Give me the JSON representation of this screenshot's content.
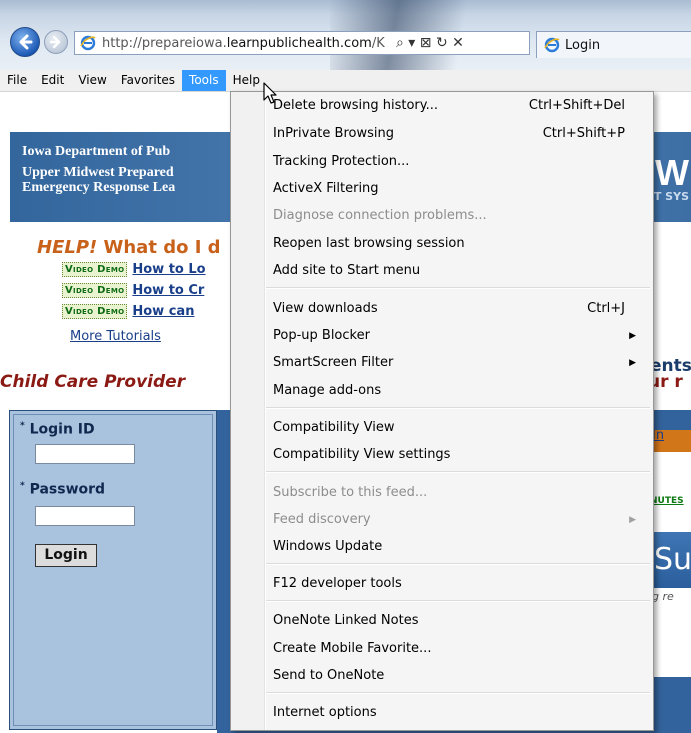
{
  "browser": {
    "address_url_pre": "http://prepareiowa.",
    "address_url_domain": "learnpublichealth.com",
    "address_url_post": "/K",
    "address_controls": "⌕ ▾ ⊠ ↻ ✕",
    "tab_title": "Login"
  },
  "menubar": {
    "items": [
      "File",
      "Edit",
      "View",
      "Favorites",
      "Tools",
      "Help"
    ],
    "active": "Tools"
  },
  "page": {
    "banner_line1": "Iowa Department of Pub",
    "banner_line2a": "Upper Midwest Prepared",
    "banner_line2b": "Emergency Response Lea",
    "banner_right_big": "OW",
    "banner_right_small": "T SYS",
    "help_prefix": "HELP!",
    "help_rest": " What do I d",
    "demos": [
      {
        "badge": "Video Demo",
        "link": "How to Lo"
      },
      {
        "badge": "Video Demo",
        "link": "How to Cr"
      },
      {
        "badge": "Video Demo",
        "link": "How can"
      }
    ],
    "more_tutorials": "More Tutorials",
    "ccp_left": "Child Care Provider",
    "ccp_right": "ur r",
    "login": {
      "login_id_label": "Login ID",
      "password_label": "Password",
      "login_button": "Login",
      "required_mark": "*"
    },
    "right_ents": "ents",
    "right_in": "In",
    "right_nutes": "NUTES",
    "right_su": "Su",
    "right_re": "ng re"
  },
  "tools_menu": {
    "items": [
      {
        "label": "Delete browsing history...",
        "shortcut": "Ctrl+Shift+Del",
        "disabled": false,
        "submenu": false
      },
      {
        "label": "InPrivate Browsing",
        "shortcut": "Ctrl+Shift+P",
        "disabled": false,
        "submenu": false
      },
      {
        "label": "Tracking Protection...",
        "shortcut": "",
        "disabled": false,
        "submenu": false
      },
      {
        "label": "ActiveX Filtering",
        "shortcut": "",
        "disabled": false,
        "submenu": false
      },
      {
        "label": "Diagnose connection problems...",
        "shortcut": "",
        "disabled": true,
        "submenu": false
      },
      {
        "label": "Reopen last browsing session",
        "shortcut": "",
        "disabled": false,
        "submenu": false
      },
      {
        "label": "Add site to Start menu",
        "shortcut": "",
        "disabled": false,
        "submenu": false
      },
      {
        "label": "View downloads",
        "shortcut": "Ctrl+J",
        "disabled": false,
        "submenu": false
      },
      {
        "label": "Pop-up Blocker",
        "shortcut": "",
        "disabled": false,
        "submenu": true
      },
      {
        "label": "SmartScreen Filter",
        "shortcut": "",
        "disabled": false,
        "submenu": true
      },
      {
        "label": "Manage add-ons",
        "shortcut": "",
        "disabled": false,
        "submenu": false
      },
      {
        "label": "Compatibility View",
        "shortcut": "",
        "disabled": false,
        "submenu": false
      },
      {
        "label": "Compatibility View settings",
        "shortcut": "",
        "disabled": false,
        "submenu": false
      },
      {
        "label": "Subscribe to this feed...",
        "shortcut": "",
        "disabled": true,
        "submenu": false
      },
      {
        "label": "Feed discovery",
        "shortcut": "",
        "disabled": true,
        "submenu": true
      },
      {
        "label": "Windows Update",
        "shortcut": "",
        "disabled": false,
        "submenu": false
      },
      {
        "label": "F12 developer tools",
        "shortcut": "",
        "disabled": false,
        "submenu": false
      },
      {
        "label": "OneNote Linked Notes",
        "shortcut": "",
        "disabled": false,
        "submenu": false
      },
      {
        "label": "Create Mobile Favorite...",
        "shortcut": "",
        "disabled": false,
        "submenu": false
      },
      {
        "label": "Send to OneNote",
        "shortcut": "",
        "disabled": false,
        "submenu": false
      },
      {
        "label": "Internet options",
        "shortcut": "",
        "disabled": false,
        "submenu": false
      }
    ]
  }
}
